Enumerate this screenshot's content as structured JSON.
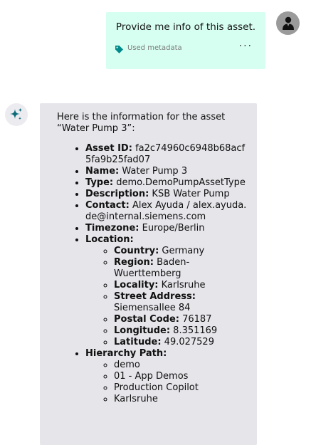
{
  "user_message": {
    "text": "Provide me info of this asset.",
    "meta_label": "Used metadata",
    "more_label": "···"
  },
  "assistant_message": {
    "intro": "Here is the information for the asset “Water Pump 3”:",
    "fields": {
      "asset_id": {
        "key": "Asset ID:",
        "value": "fa2c74960c6948b68acf5fa9b25fad07"
      },
      "name": {
        "key": "Name:",
        "value": "Water Pump 3"
      },
      "type": {
        "key": "Type:",
        "value": "demo.DemoPumpAssetType"
      },
      "description": {
        "key": "Description:",
        "value": "KSB Water Pump"
      },
      "contact": {
        "key": "Contact:",
        "value": "Alex Ayuda / alex.ayuda.de@internal.siemens.com"
      },
      "timezone": {
        "key": "Timezone:",
        "value": "Europe/Berlin"
      },
      "location": {
        "key": "Location:"
      }
    },
    "location": {
      "country": {
        "key": "Country:",
        "value": "Germany"
      },
      "region": {
        "key": "Region:",
        "value": "Baden-Wuerttemberg"
      },
      "locality": {
        "key": "Locality:",
        "value": "Karlsruhe"
      },
      "street": {
        "key": "Street Address:",
        "value": "Siemensallee 84"
      },
      "postal": {
        "key": "Postal Code:",
        "value": "76187"
      },
      "longitude": {
        "key": "Longitude:",
        "value": "8.351169"
      },
      "latitude": {
        "key": "Latitude:",
        "value": "49.027529"
      }
    },
    "hierarchy": {
      "key": "Hierarchy Path:",
      "items": [
        "demo",
        "01 - App Demos",
        "Production Copilot",
        "Karlsruhe"
      ]
    }
  },
  "colors": {
    "user_bubble": "#d7fff1",
    "assistant_bubble": "#e5e5ea",
    "tag_icon": "#008a8a",
    "sparkle_icon": "#0c6b78",
    "avatar_bg": "#9a9a9a"
  },
  "icons": {
    "user_avatar": "person-icon",
    "assistant_avatar": "sparkle-icon",
    "metadata": "tag-icon"
  }
}
